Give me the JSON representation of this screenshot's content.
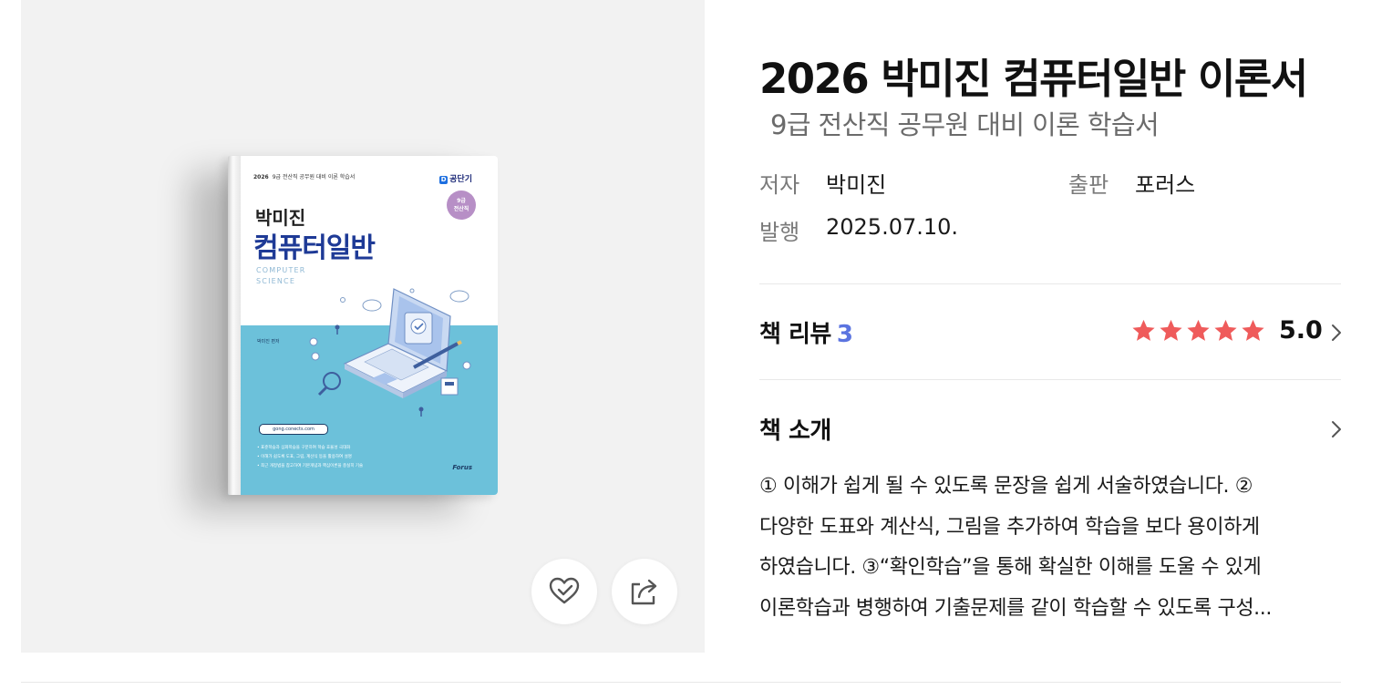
{
  "book": {
    "title": "2026 박미진 컴퓨터일반 이론서",
    "subtitle": "9급 전산직 공무원 대비 이론 학습서",
    "meta": {
      "author_label": "저자",
      "author": "박미진",
      "publisher_label": "출판",
      "publisher": "포러스",
      "date_label": "발행",
      "date": "2025.07.10."
    }
  },
  "cover": {
    "top_year": "2026",
    "top_text": "9급 전산직 공무원 대비 이론 학습서",
    "brand": "공단기",
    "brand_mark": "D",
    "badge_line1": "9급",
    "badge_line2": "전산직",
    "author": "박미진",
    "title": "컴퓨터일반",
    "en_line1": "COMPUTER",
    "en_line2": "SCIENCE",
    "editor": "박미진 편저",
    "url": "gong.conects.com",
    "bullet1": "• 표준학습과 심화학습을 구분하여 학습 효율성 극대화",
    "bullet2": "• 이해가 쉽도록 도표, 그림, 계산식 등을 활용하여 설명",
    "bullet3": "• 최근 개정법을 참고하여 기본개념과 핵심이론을 충실히 기술",
    "publisher_mark": "Forus"
  },
  "actions": {
    "wish_icon": "heart-check-icon",
    "share_icon": "share-icon"
  },
  "review": {
    "label": "책 리뷰",
    "count": "3",
    "rating": "5.0",
    "rating_value": 5,
    "rating_max": 5,
    "star_color": "#ef5b5b"
  },
  "intro": {
    "label": "책 소개",
    "lines": [
      "① 이해가 쉽게 될 수 있도록 문장을 쉽게 서술하였습니다. ②",
      "다양한 도표와 계산식, 그림을 추가하여 학습을 보다 용이하게",
      "하였습니다. ③“확인학습”을 통해 확실한 이해를 도울 수 있게",
      "이론학습과 병행하여 기출문제를 같이 학습할 수 있도록 구성..."
    ]
  },
  "colors": {
    "panel_bg": "#f2f2f2",
    "accent_count": "#5b74e0",
    "cover_blue": "#6cc1da",
    "cover_title": "#1e3a96"
  }
}
